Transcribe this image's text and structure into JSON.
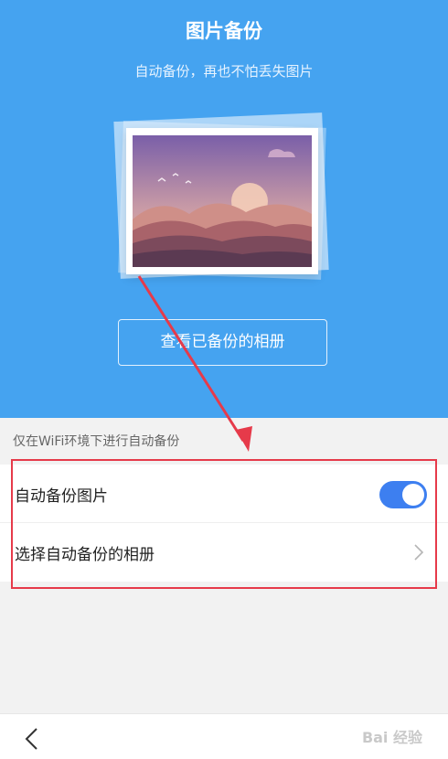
{
  "header": {
    "title": "图片备份",
    "subtitle": "自动备份，再也不怕丢失图片"
  },
  "hero": {
    "illustration_icon": "landscape-photo-icon",
    "view_button_label": "查看已备份的相册"
  },
  "settings": {
    "wifi_note": "仅在WiFi环境下进行自动备份",
    "rows": [
      {
        "label": "自动备份图片",
        "control": "toggle",
        "on": true
      },
      {
        "label": "选择自动备份的相册",
        "control": "chevron-right-icon"
      }
    ]
  },
  "bottom_bar": {
    "back_icon": "chevron-left-icon",
    "watermark": "Bai 经验"
  },
  "colors": {
    "hero_bg": "#45a3f0",
    "toggle_on": "#3d7ff0",
    "annotation": "#e63a4a",
    "page_bg": "#f2f2f2"
  }
}
